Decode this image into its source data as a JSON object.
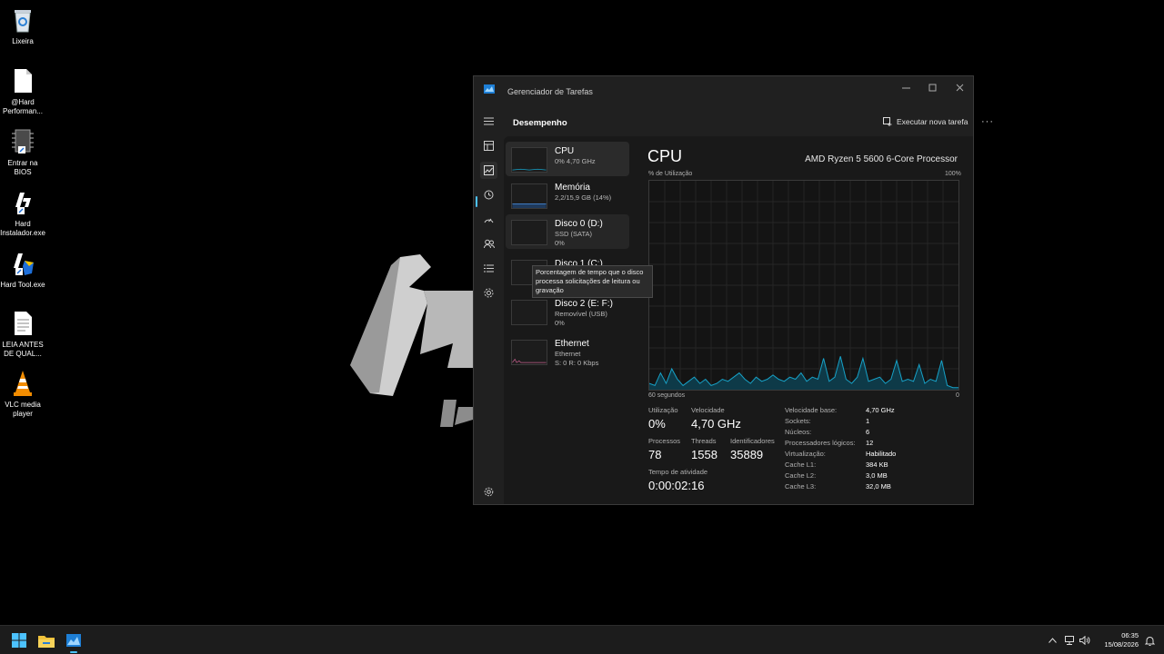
{
  "desktop": {
    "icons": [
      {
        "label": "Lixeira",
        "icon": "recycle-bin-icon"
      },
      {
        "label": "@Hard Performan...",
        "icon": "document-icon"
      },
      {
        "label": "Entrar na BIOS",
        "icon": "chip-shortcut-icon"
      },
      {
        "label": "Hard Instalador.exe",
        "icon": "hard-logo-shortcut-icon"
      },
      {
        "label": "Hard Tool.exe",
        "icon": "hard-tool-shortcut-icon"
      },
      {
        "label": "LEIA ANTES DE QUAL...",
        "icon": "text-file-icon"
      },
      {
        "label": "VLC media player",
        "icon": "vlc-cone-icon"
      }
    ]
  },
  "window": {
    "title": "Gerenciador de Tarefas",
    "header_title": "Desempenho",
    "run_task_label": "Executar nova tarefa",
    "more_label": "···"
  },
  "nav": [
    "hamburger-icon",
    "processes-icon",
    "performance-icon",
    "app-history-icon",
    "startup-icon",
    "users-icon",
    "details-icon",
    "services-icon",
    "settings-icon"
  ],
  "devices": [
    {
      "name": "CPU",
      "sub1": "0% 4,70 GHz",
      "sub2": ""
    },
    {
      "name": "Memória",
      "sub1": "2,2/15,9 GB (14%)",
      "sub2": ""
    },
    {
      "name": "Disco 0 (D:)",
      "sub1": "SSD (SATA)",
      "sub2": "0%"
    },
    {
      "name": "Disco 1 (C:)",
      "sub1": "",
      "sub2": ""
    },
    {
      "name": "Disco 2 (E: F:)",
      "sub1": "Removível (USB)",
      "sub2": "0%"
    },
    {
      "name": "Ethernet",
      "sub1": "Ethernet",
      "sub2": "S: 0 R: 0 Kbps"
    }
  ],
  "tooltip": "Porcentagem de tempo que o disco processa solicitações de leitura ou gravação",
  "perf": {
    "title": "CPU",
    "processor": "AMD Ryzen 5 5600 6-Core Processor",
    "graph_top_left": "% de Utilização",
    "graph_top_right": "100%",
    "graph_bottom_left": "60 segundos",
    "graph_bottom_right": "0",
    "stats": {
      "util_label": "Utilização",
      "util_value": "0%",
      "speed_label": "Velocidade",
      "speed_value": "4,70 GHz",
      "proc_label": "Processos",
      "proc_value": "78",
      "threads_label": "Threads",
      "threads_value": "1558",
      "handles_label": "Identificadores",
      "handles_value": "35889",
      "uptime_label": "Tempo de atividade",
      "uptime_value": "0:00:02:16"
    },
    "specs": [
      {
        "k": "Velocidade base:",
        "v": "4,70 GHz"
      },
      {
        "k": "Sockets:",
        "v": "1"
      },
      {
        "k": "Núcleos:",
        "v": "6"
      },
      {
        "k": "Processadores lógicos:",
        "v": "12"
      },
      {
        "k": "Virtualização:",
        "v": "Habilitado"
      },
      {
        "k": "Cache L1:",
        "v": "384 KB"
      },
      {
        "k": "Cache L2:",
        "v": "3,0 MB"
      },
      {
        "k": "Cache L3:",
        "v": "32,0 MB"
      }
    ],
    "cpu_history": [
      3,
      2,
      8,
      3,
      10,
      5,
      2,
      4,
      6,
      3,
      5,
      2,
      3,
      5,
      4,
      6,
      8,
      5,
      3,
      6,
      4,
      5,
      7,
      5,
      4,
      6,
      5,
      8,
      4,
      6,
      5,
      15,
      4,
      6,
      16,
      5,
      3,
      6,
      15,
      4,
      5,
      6,
      3,
      5,
      14,
      4,
      5,
      4,
      12,
      3,
      5,
      4,
      14,
      2,
      1,
      1
    ]
  },
  "taskbar": {
    "time": "06:35",
    "date": "15/08/2026"
  },
  "colors": {
    "accent": "#4cc2ff",
    "graph_line": "#17a2c8"
  }
}
